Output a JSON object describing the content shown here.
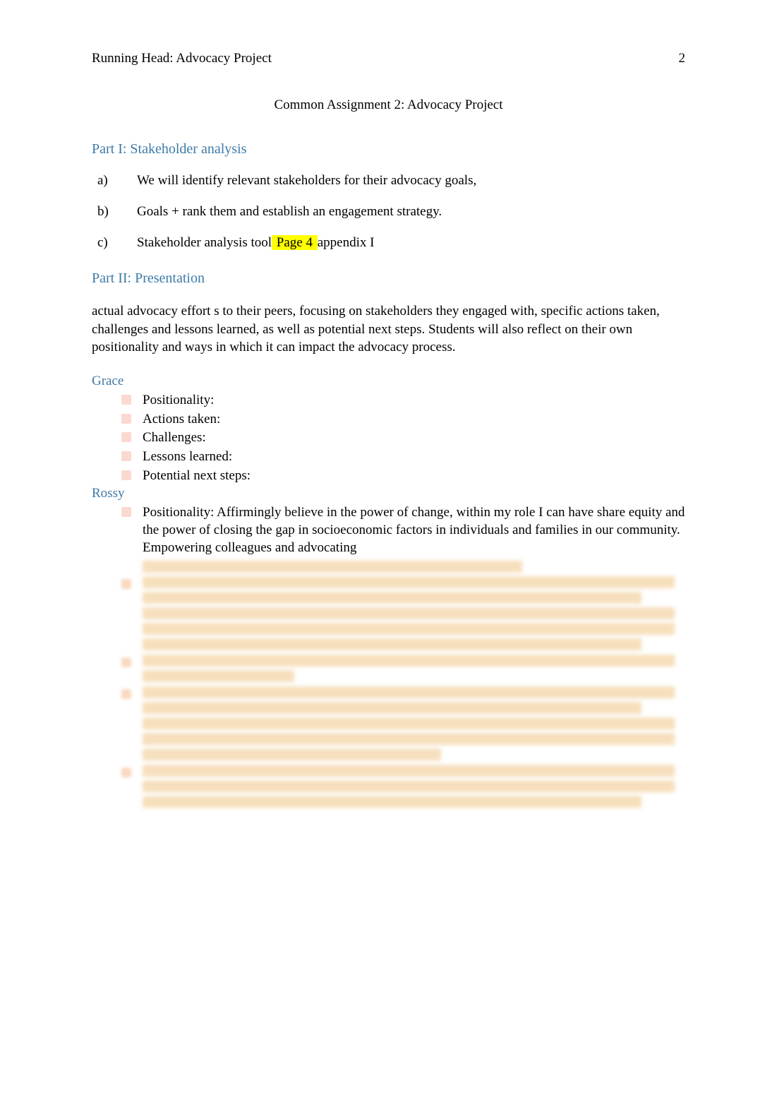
{
  "header": {
    "running_head": "Running Head: Advocacy Project",
    "page_number": "2"
  },
  "title": "Common Assignment 2: Advocacy Project",
  "part1": {
    "heading": "Part I:   Stakeholder analysis",
    "items": [
      {
        "marker": "a)",
        "text": "We will identify relevant stakeholders for their advocacy goals,"
      },
      {
        "marker": "b)",
        "text": "Goals + rank them and establish an engagement strategy."
      },
      {
        "marker": "c)",
        "text_before": "Stakeholder analysis tool",
        "highlight": " Page 4 ",
        "text_after": "appendix I"
      }
    ]
  },
  "part2": {
    "heading": "Part II:   Presentation",
    "paragraph": "actual advocacy effort s to their peers, focusing on stakeholders they engaged with, specific actions taken, challenges and lessons learned, as well as potential next steps. Students will also reflect on their own positionality and ways in which it can impact the advocacy process."
  },
  "grace": {
    "heading": "Grace",
    "items": [
      "Positionality:",
      "Actions taken:",
      "Challenges:",
      "Lessons learned:",
      "Potential next steps:"
    ]
  },
  "rossy": {
    "heading": "Rossy",
    "positionality": "Positionality:  Affirmingly believe in the power of change, within my role I can have share equity and the power of closing the gap in socioeconomic factors in individuals and families in our community. Empowering colleagues and advocating"
  }
}
